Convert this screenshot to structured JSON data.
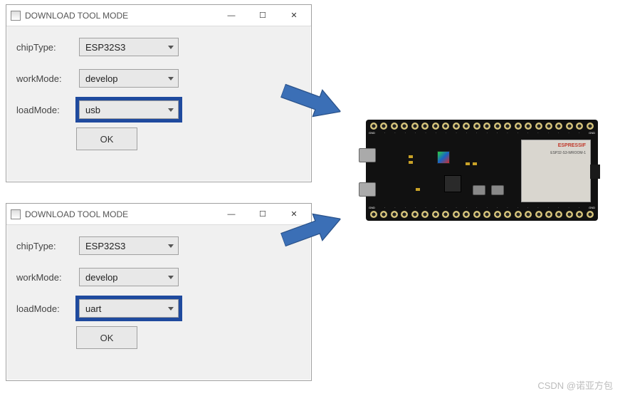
{
  "dialog1": {
    "title": "DOWNLOAD TOOL MODE",
    "rows": {
      "chipType": {
        "label": "chipType:",
        "value": "ESP32S3"
      },
      "workMode": {
        "label": "workMode:",
        "value": "develop"
      },
      "loadMode": {
        "label": "loadMode:",
        "value": "usb"
      }
    },
    "ok": "OK"
  },
  "dialog2": {
    "title": "DOWNLOAD TOOL MODE",
    "rows": {
      "chipType": {
        "label": "chipType:",
        "value": "ESP32S3"
      },
      "workMode": {
        "label": "workMode:",
        "value": "develop"
      },
      "loadMode": {
        "label": "loadMode:",
        "value": "uart"
      }
    },
    "ok": "OK"
  },
  "board": {
    "moduleBrand": "ESPRESSIF",
    "moduleName": "ESP32-S3-WROOM-1",
    "topFirst": "GND",
    "topLast": "GND",
    "botFirst": "GND",
    "botLast": "GND",
    "pinCount": 22
  },
  "watermark": "CSDN @诺亚方包",
  "winbuttons": {
    "min": "—",
    "max": "☐",
    "close": "✕"
  },
  "colors": {
    "arrow": "#3b6fb6",
    "highlight": "#1f4a9e"
  }
}
